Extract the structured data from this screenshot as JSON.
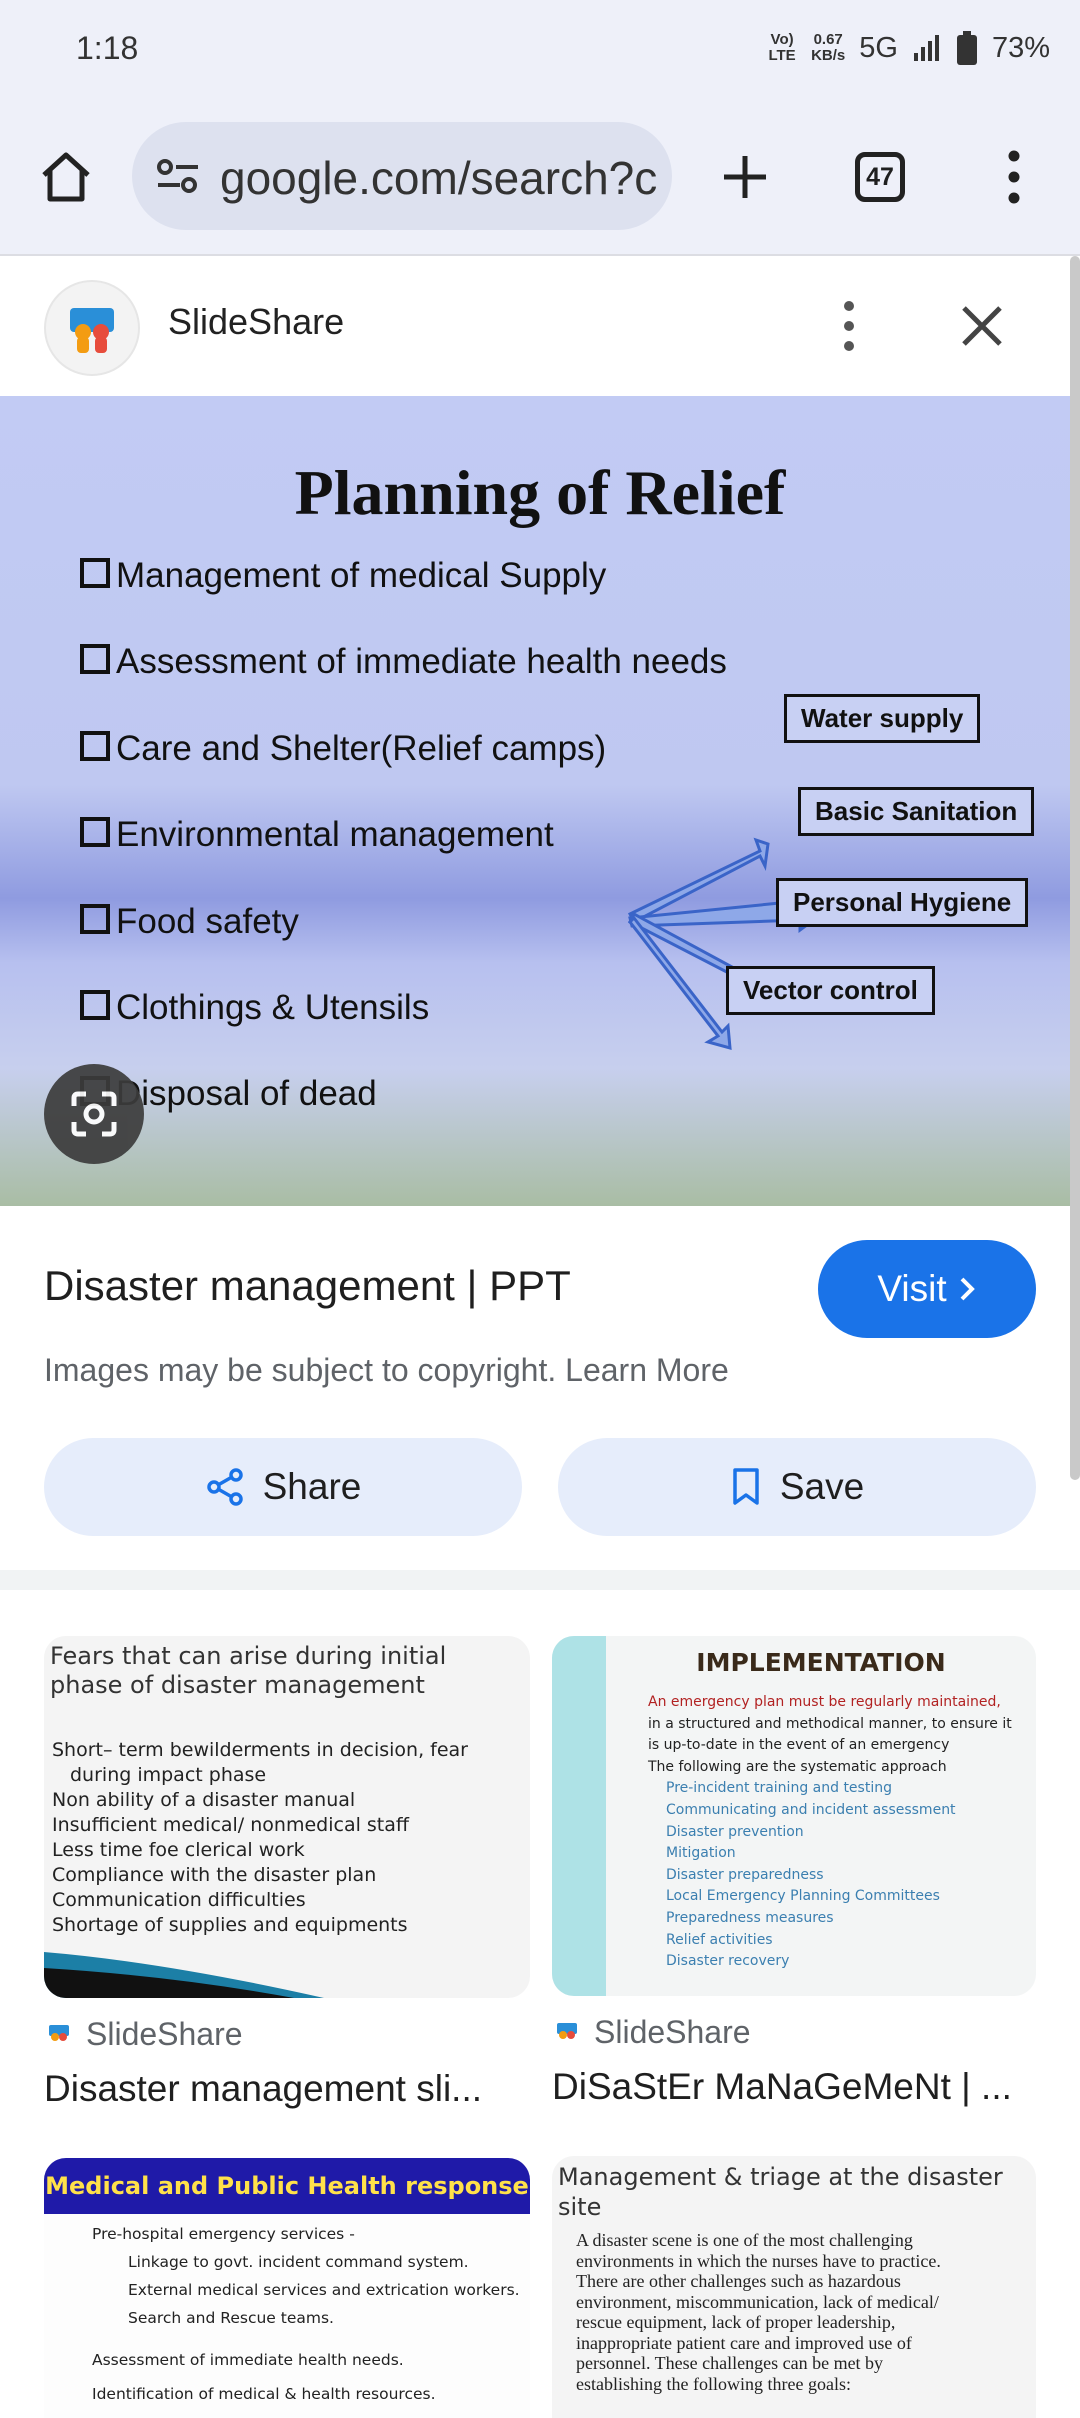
{
  "status_bar": {
    "time": "1:18",
    "volte": "Vo) LTE",
    "speed_value": "0.67",
    "speed_unit": "KB/s",
    "network": "5G",
    "battery": "73%"
  },
  "browser": {
    "url": "google.com/search?cl",
    "tab_count": "47"
  },
  "panel": {
    "source": "SlideShare"
  },
  "slide": {
    "title": "Planning of Relief",
    "bullets": [
      "Management of medical Supply",
      "Assessment of immediate health needs",
      "Care and Shelter(Relief camps)",
      "Environmental management",
      "Food safety",
      "Clothings & Utensils",
      "Disposal of dead"
    ],
    "tags": [
      "Water supply",
      "Basic Sanitation",
      "Personal Hygiene",
      "Vector control"
    ]
  },
  "result": {
    "title": "Disaster management | PPT",
    "visit_label": "Visit",
    "copyright": "Images may be subject to copyright. Learn More",
    "share_label": "Share",
    "save_label": "Save"
  },
  "related": [
    {
      "source": "SlideShare",
      "title": "Disaster management sli...",
      "heading": "Fears that can arise during initial phase of disaster management",
      "lines": [
        "Short– term bewilderments in decision, fear",
        "during impact phase",
        "Non ability of a disaster manual",
        "Insufficient medical/ nonmedical staff",
        "Less time foe clerical work",
        "Compliance with the disaster plan",
        "Communication difficulties",
        "Shortage of supplies and equipments"
      ]
    },
    {
      "source": "SlideShare",
      "title": "DiSaStEr MaNaGeMeNt | ...",
      "heading": "IMPLEMENTATION",
      "lines": [
        "An emergency plan must be regularly maintained,",
        "in a structured and methodical manner, to ensure it",
        "is up-to-date in the event of an emergency",
        "The following are the systematic approach",
        "Pre-incident training and testing",
        "Communicating and incident assessment",
        "Disaster prevention",
        "Mitigation",
        "Disaster preparedness",
        "Local Emergency Planning Committees",
        "Preparedness measures",
        "Relief activities",
        "Disaster recovery"
      ]
    },
    {
      "heading": "Medical and Public Health response",
      "lines": [
        "Pre-hospital emergency services -",
        "Linkage to govt. incident command system.",
        "External medical services and extrication workers.",
        "Search and Rescue teams.",
        "Assessment of immediate health needs.",
        "Identification of medical & health resources."
      ]
    },
    {
      "heading": "Management & triage at the disaster site",
      "lines": [
        "A disaster scene is one of the most challenging",
        "environments in which the nurses have to practice.",
        "There are other challenges such as hazardous",
        "environment, miscommunication, lack of medical/",
        "rescue equipment, lack of proper leadership,",
        "inappropriate patient care and improved use of",
        "personnel. These challenges can be met by",
        "establishing the following three goals:"
      ]
    }
  ]
}
